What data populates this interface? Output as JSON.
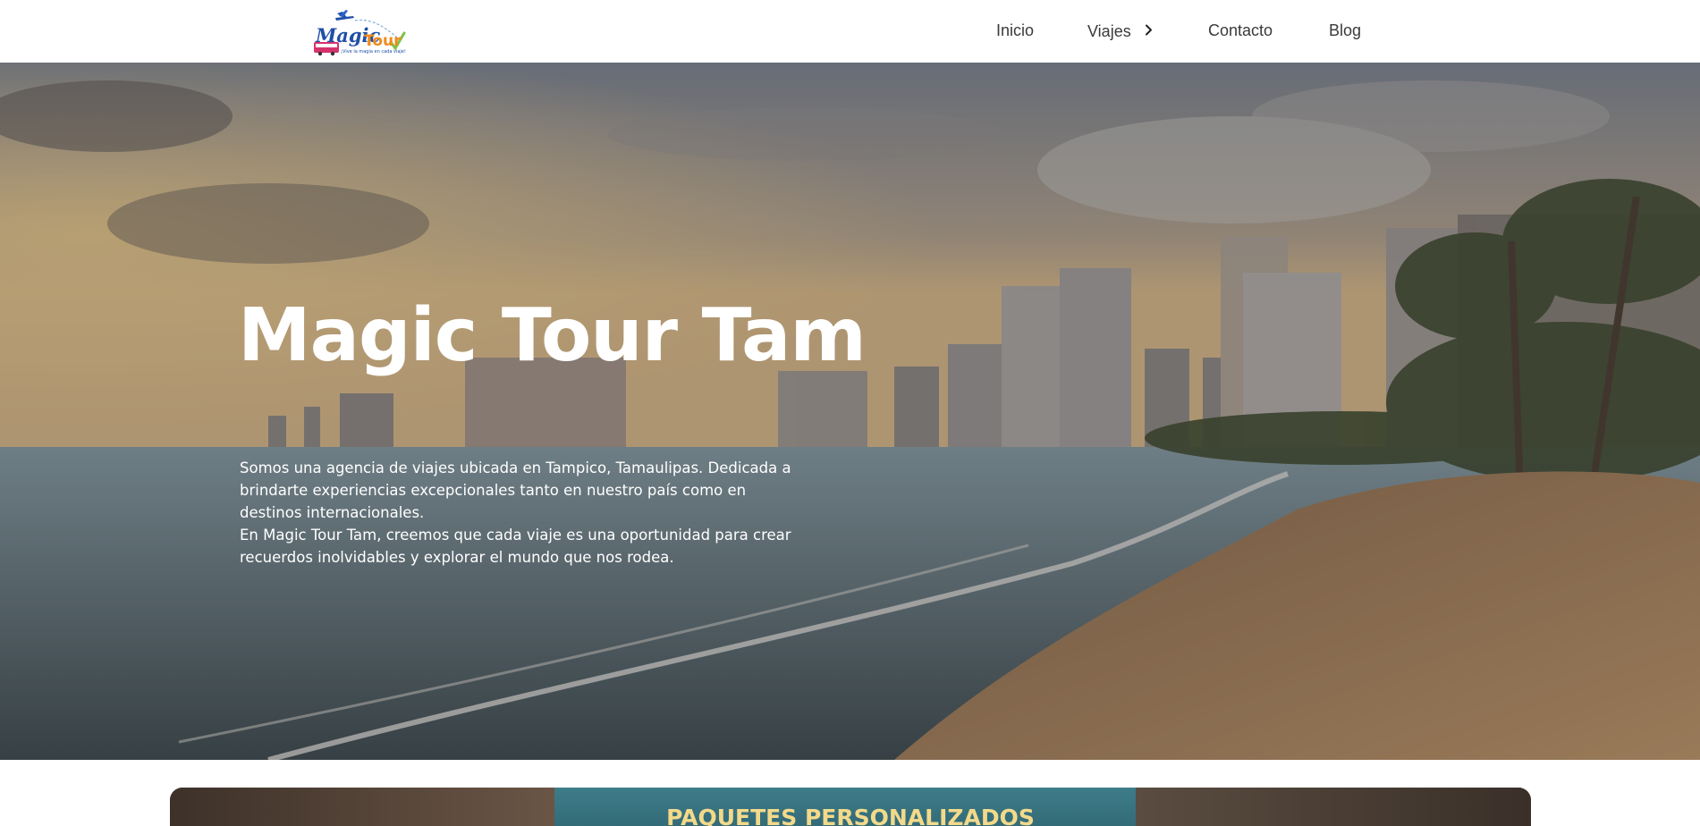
{
  "header": {
    "logo": {
      "text_main": "Magic",
      "text_secondary": "Tour",
      "tagline": "¡Vive la magia en cada viaje!",
      "icon": "airplane-logo"
    },
    "nav": {
      "inicio": "Inicio",
      "viajes": "Viajes",
      "contacto": "Contacto",
      "blog": "Blog"
    }
  },
  "hero": {
    "title": "Magic Tour Tam",
    "paragraph1": "Somos una agencia de viajes ubicada en Tampico, Tamaulipas. Dedicada a brindarte experiencias excepcionales tanto en nuestro país como en destinos internacionales.",
    "paragraph2": "En Magic Tour Tam, creemos que cada viaje es una oportunidad para crear recuerdos inolvidables y explorar el mundo que nos rodea."
  },
  "section": {
    "card_title": "PAQUETES PERSONALIZADOS"
  },
  "colors": {
    "nav_text": "#3a3a3a",
    "hero_text": "#ffffff",
    "card_title": "#f3d98a"
  }
}
